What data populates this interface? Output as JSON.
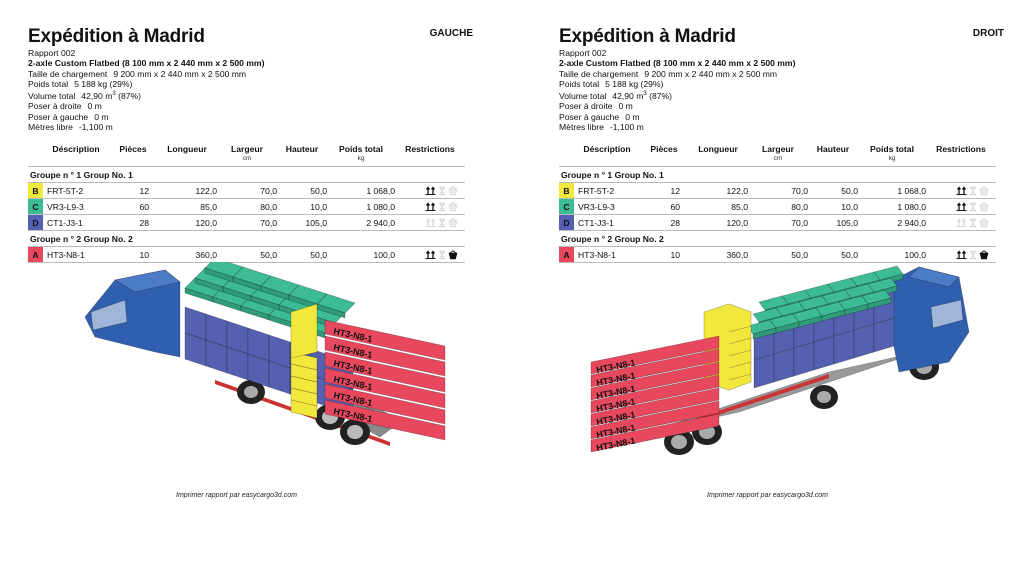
{
  "report": {
    "title": "Expédition à Madrid",
    "report_no": "Rapport 002",
    "vehicle": "2-axle Custom Flatbed (8 100 mm x 2 440 mm x 2 500 mm)",
    "stats": [
      {
        "label": "Taille de chargement",
        "value": "9 200 mm x 2 440 mm x 2 500 mm"
      },
      {
        "label": "Poids total",
        "value": "5 188 kg (29%)"
      },
      {
        "label": "Volume total",
        "value_main": "42,90 m",
        "value_sup": "3",
        "value_tail": " (87%)"
      },
      {
        "label": "Poser à droite",
        "value": "0 m"
      },
      {
        "label": "Poser à gauche",
        "value": "0 m"
      },
      {
        "label": "Mètres libre",
        "value": "-1,100 m"
      }
    ],
    "footer": "Imprimer rapport par easycargo3d.com"
  },
  "views": [
    {
      "side_label": "GAUCHE"
    },
    {
      "side_label": "DROIT"
    }
  ],
  "table": {
    "headers": {
      "description": "Déscription",
      "pieces": "Pièces",
      "length": "Longueur",
      "width": "Largeur",
      "width_unit": "cm",
      "height": "Hauteur",
      "weight": "Poids total",
      "weight_unit": "kg",
      "restrictions": "Restrictions"
    },
    "groups": [
      {
        "label": "Groupe n ° 1 Group No. 1",
        "items": [
          {
            "badge": "B",
            "color": "#f2e83b",
            "desc": "FRT-5T-2",
            "pieces": "12",
            "length": "122,0",
            "width": "70,0",
            "height": "50,0",
            "weight": "1 068,0",
            "this_side_up": true,
            "no_stack": false,
            "fragile": false
          },
          {
            "badge": "C",
            "color": "#3dbb94",
            "desc": "VR3-L9-3",
            "pieces": "60",
            "length": "85,0",
            "width": "80,0",
            "height": "10,0",
            "weight": "1 080,0",
            "this_side_up": true,
            "no_stack": false,
            "fragile": false
          },
          {
            "badge": "D",
            "color": "#5561b0",
            "desc": "CT1-J3-1",
            "pieces": "28",
            "length": "120,0",
            "width": "70,0",
            "height": "105,0",
            "weight": "2 940,0",
            "this_side_up": false,
            "no_stack": false,
            "fragile": false
          }
        ]
      },
      {
        "label": "Groupe n ° 2 Group No. 2",
        "items": [
          {
            "badge": "A",
            "color": "#e8485e",
            "desc": "HT3-N8-1",
            "pieces": "10",
            "length": "360,0",
            "width": "50,0",
            "height": "50,0",
            "weight": "100,0",
            "this_side_up": true,
            "no_stack": false,
            "fragile": true
          }
        ]
      }
    ]
  },
  "cargo_labels": {
    "A": "HT3-N8-1",
    "B": "FRT-5T-2",
    "C": "VR3-L9-3",
    "D": "CT1-J3-1"
  },
  "colors": {
    "truck_blue": "#2f5fae",
    "cargo_A": "#e8485e",
    "cargo_B": "#f2e83b",
    "cargo_C": "#3dbb94",
    "cargo_D": "#5561b0"
  }
}
